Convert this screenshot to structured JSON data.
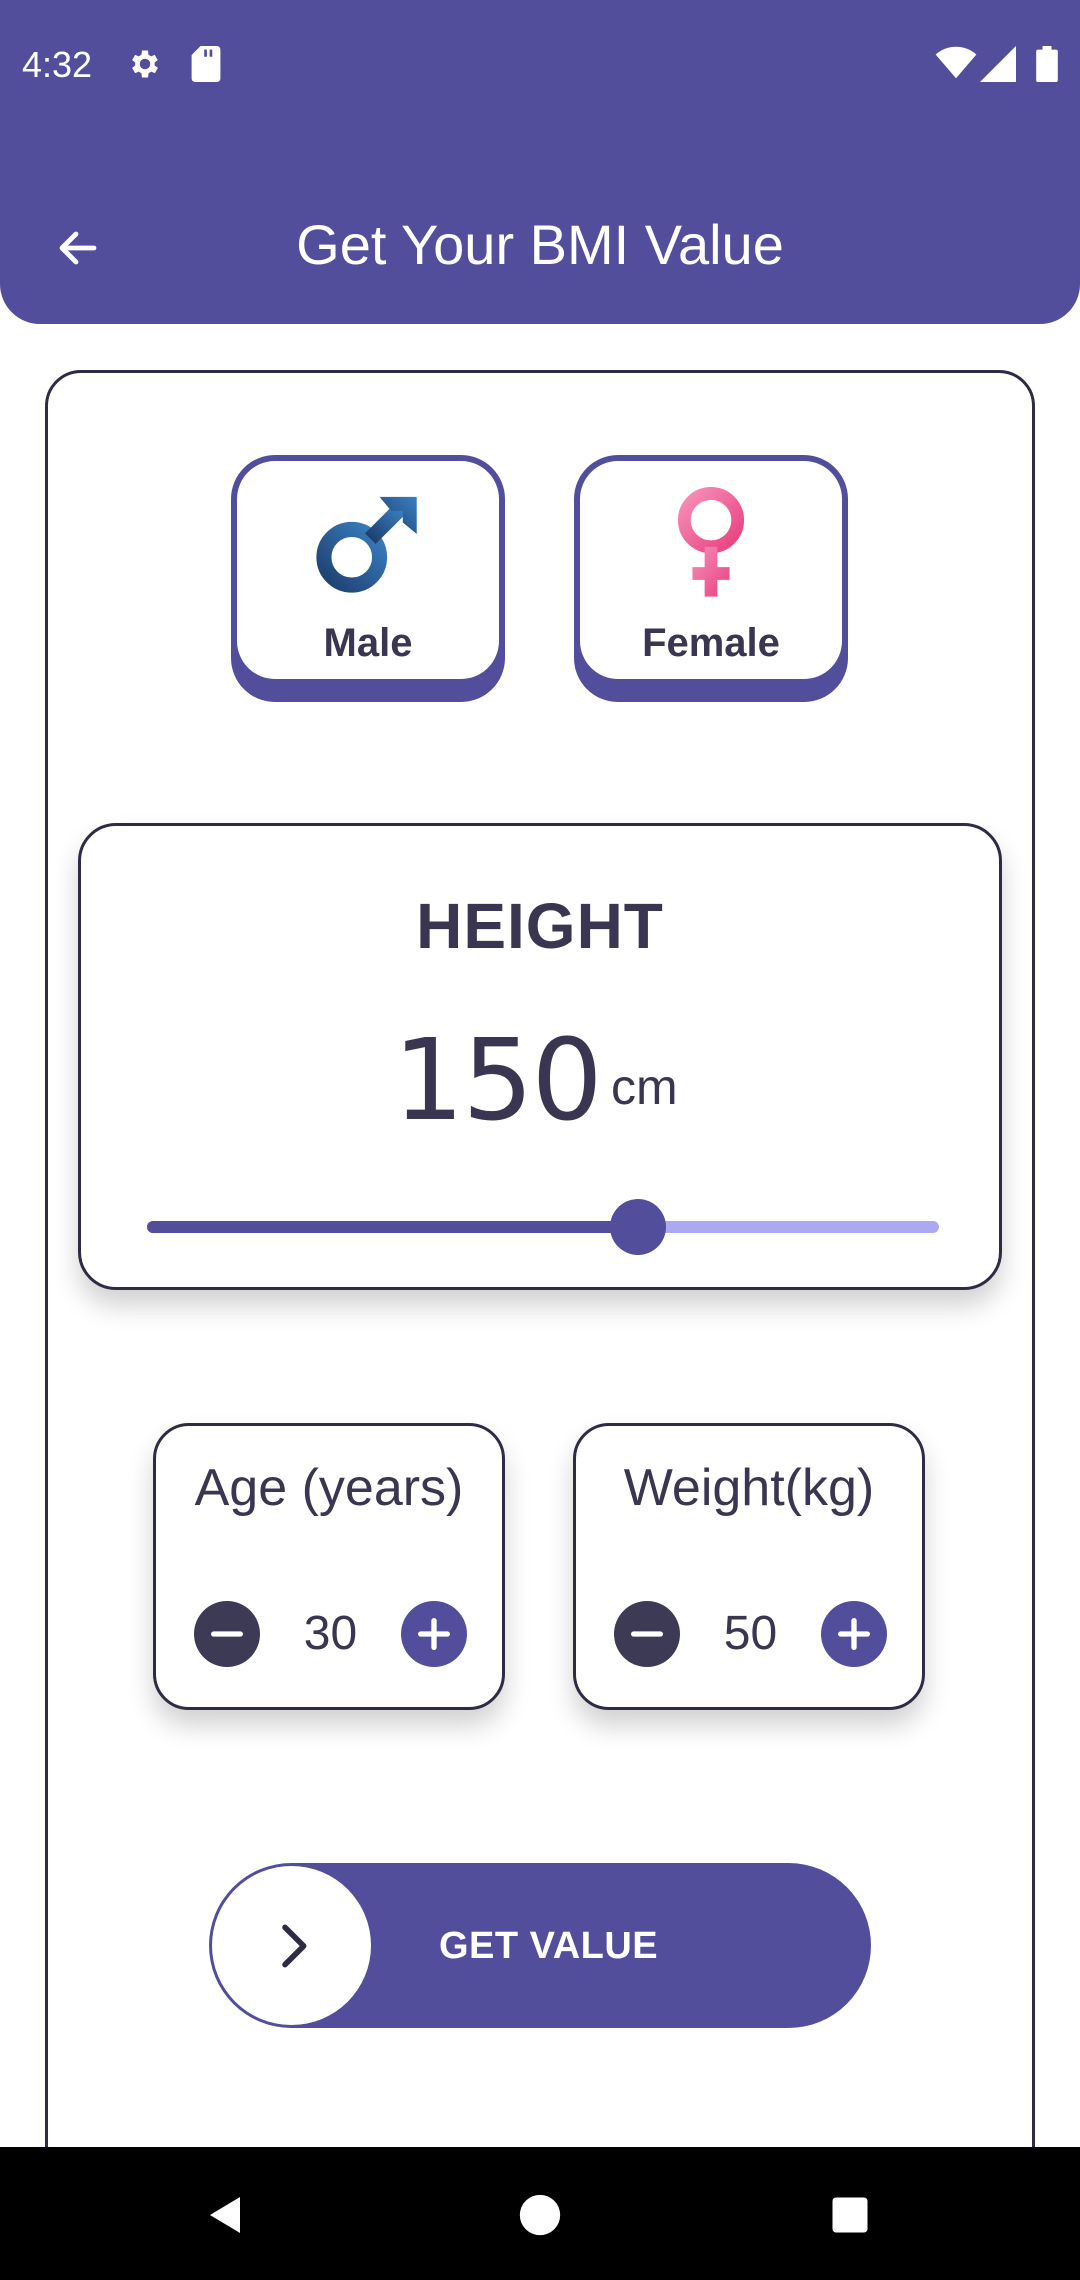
{
  "status_bar": {
    "time": "4:32",
    "icons": [
      "gear-icon",
      "sd-card-icon",
      "wifi-icon",
      "signal-icon",
      "battery-icon"
    ]
  },
  "app_bar": {
    "title": "Get Your BMI Value",
    "back_icon": "arrow-left-icon"
  },
  "gender": {
    "male_label": "Male",
    "female_label": "Female",
    "male_icon": "male-symbol-icon",
    "female_icon": "female-symbol-icon"
  },
  "height": {
    "title": "HEIGHT",
    "value": "150",
    "unit": "cm",
    "slider_fraction": 0.62
  },
  "age": {
    "label": "Age (years)",
    "value": "30"
  },
  "weight": {
    "label": "Weight(kg)",
    "value": "50"
  },
  "action": {
    "label": "GET VALUE",
    "icon": "chevron-right-icon"
  },
  "colors": {
    "primary": "#524e9c",
    "primary_light": "#aca9f0",
    "dark": "#3c3a54",
    "male_blue": "#2c5b93",
    "female_pink": "#f06b9f"
  }
}
